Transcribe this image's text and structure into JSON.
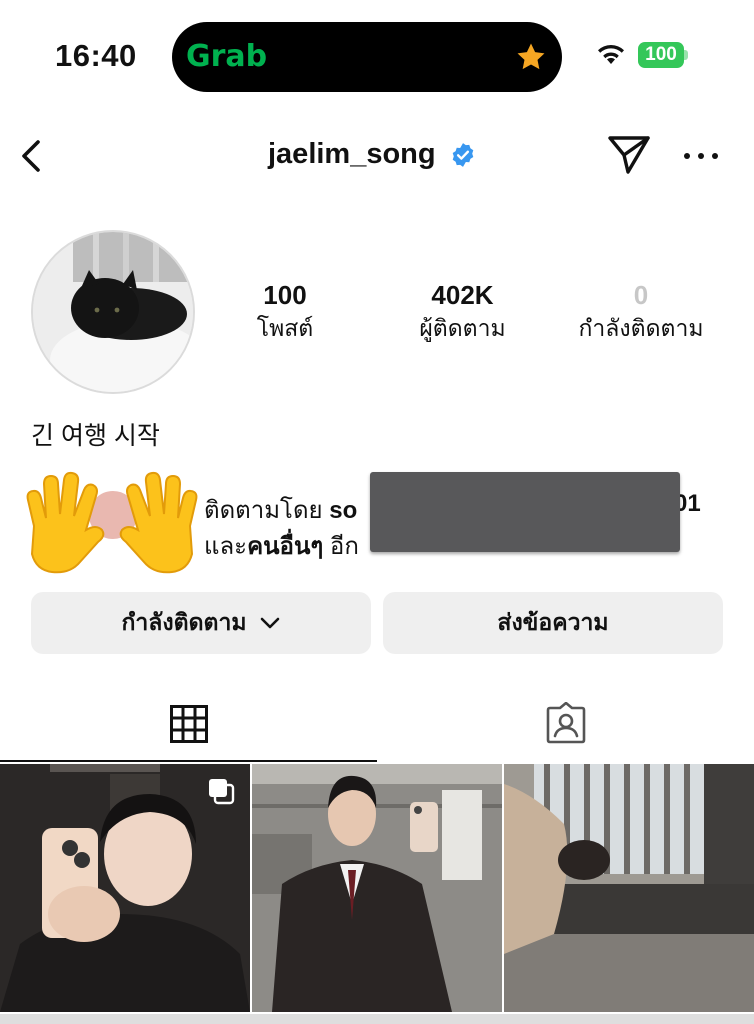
{
  "status_bar": {
    "time": "16:40",
    "live_activity_brand": "Grab",
    "battery": "100",
    "icons": [
      "star-icon",
      "wifi-icon",
      "battery-icon"
    ]
  },
  "nav": {
    "username": "jaelim_song",
    "icons": [
      "back-icon",
      "verified-badge-icon",
      "send-icon",
      "more-icon"
    ]
  },
  "profile": {
    "stats": {
      "posts_count": "100",
      "posts_label": "โพสต์",
      "followers_count": "402K",
      "followers_label": "ผู้ติดตาม",
      "following_count": "0",
      "following_label": "กำลังติดตาม"
    },
    "bio": "긴 여행 시작",
    "followed_by": {
      "line1_prefix": "ติดตามโดย ",
      "line1_name_start": "so",
      "line1_tail": "01",
      "line2_prefix": "และ",
      "line2_bold": "คนอื่นๆ",
      "line2_suffix": " อีก",
      "emoji": "raised-hands"
    }
  },
  "actions": {
    "following_label": "กำลังติดตาม",
    "message_label": "ส่งข้อความ"
  },
  "tabs": {
    "items": [
      "grid-icon",
      "tagged-icon"
    ],
    "active": "grid-icon"
  },
  "colors": {
    "accent_verified": "#3897f0",
    "grab_green": "#00b14f",
    "battery_green": "#34c759",
    "button_bg": "#efefef"
  }
}
